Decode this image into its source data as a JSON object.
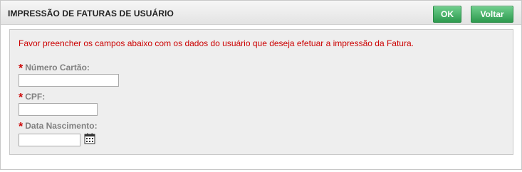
{
  "header": {
    "title": "IMPRESSÃO DE FATURAS DE USUÁRIO",
    "ok_label": "OK",
    "back_label": "Voltar"
  },
  "form": {
    "instruction": "Favor preencher os campos abaixo com os dados do usuário que deseja efetuar a impressão da Fatura.",
    "required_marker": "*",
    "fields": [
      {
        "label": "Número Cartão:",
        "value": ""
      },
      {
        "label": "CPF:",
        "value": ""
      },
      {
        "label": "Data Nascimento:",
        "value": ""
      }
    ]
  },
  "icons": {
    "date_picker": "calendar-icon"
  },
  "colors": {
    "accent_green": "#2e9a4f",
    "required_red": "#cc0000",
    "label_gray": "#808080"
  }
}
